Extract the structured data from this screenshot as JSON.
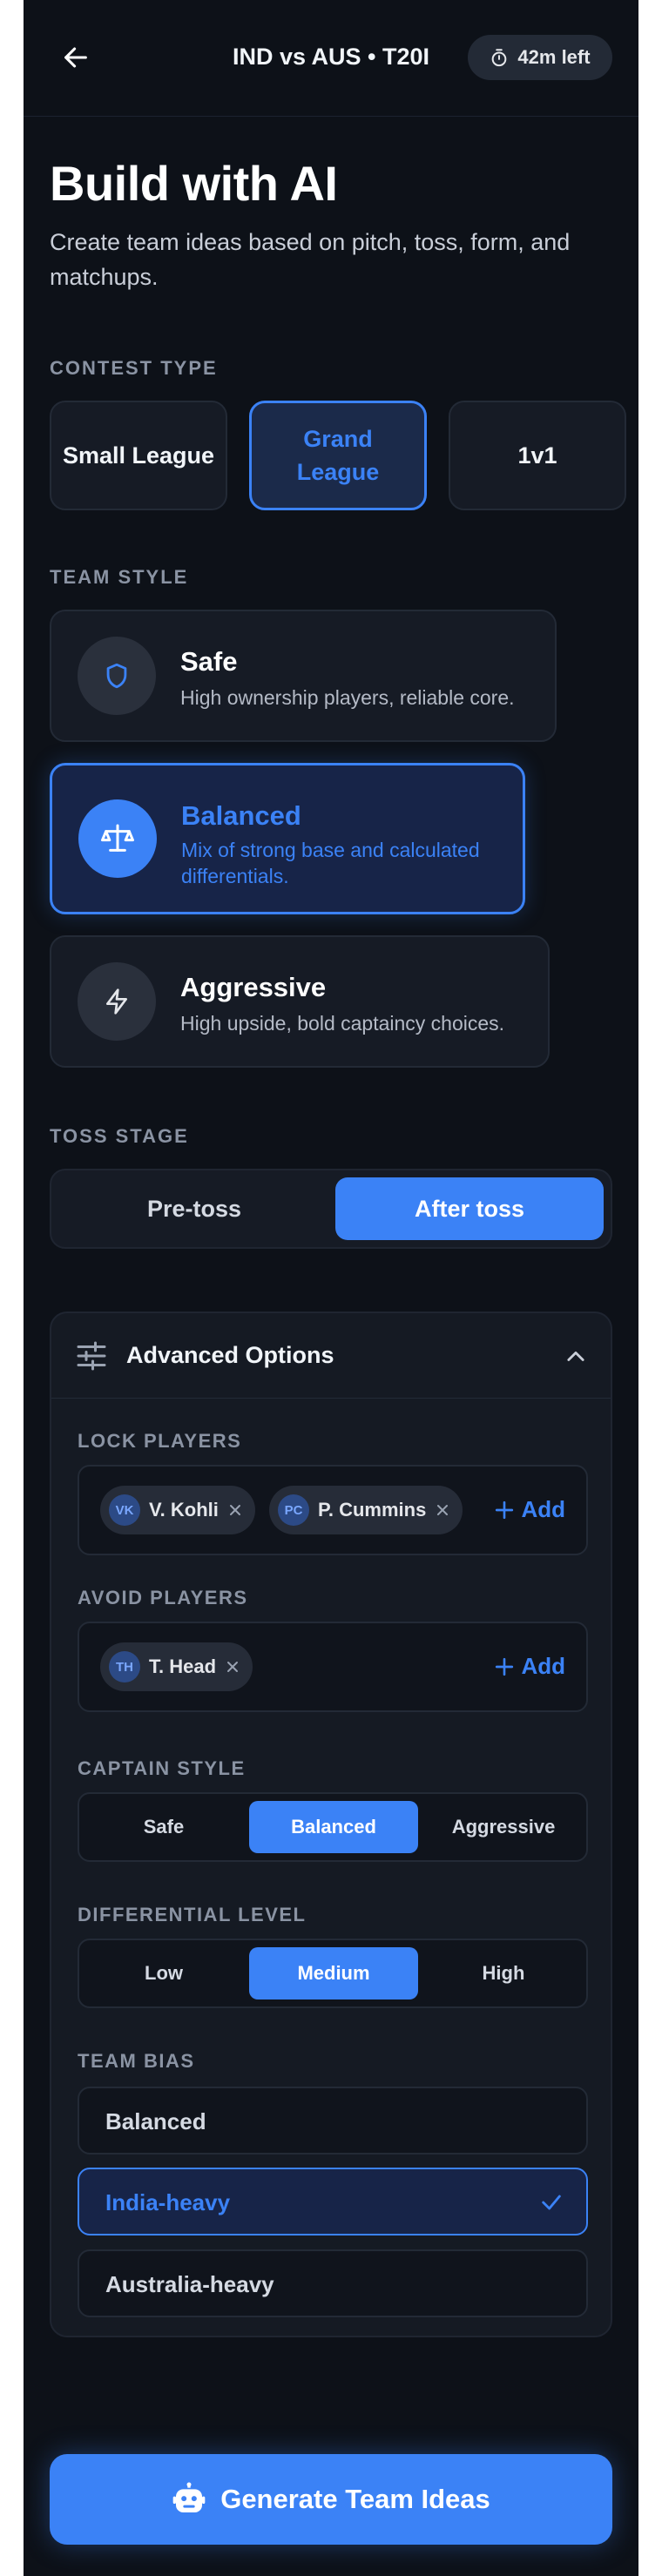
{
  "header": {
    "match_title": "IND vs AUS • T20I",
    "timer": "42m left",
    "back_icon": "arrow-left-icon",
    "timer_icon": "stopwatch-icon"
  },
  "hero": {
    "title": "Build with AI",
    "subtitle": "Create team ideas based on pitch, toss, form, and matchups."
  },
  "contest": {
    "label": "CONTEST TYPE",
    "options": [
      "Small League",
      "Grand League",
      "1v1"
    ],
    "selected": "Grand League"
  },
  "team_style": {
    "label": "TEAM STYLE",
    "options": [
      {
        "title": "Safe",
        "desc": "High ownership players, reliable core.",
        "icon": "shield-icon"
      },
      {
        "title": "Balanced",
        "desc": "Mix of strong base and calculated differentials.",
        "icon": "scale-icon"
      },
      {
        "title": "Aggressive",
        "desc": "High upside, bold captaincy choices.",
        "icon": "lightning-icon"
      }
    ],
    "selected": "Balanced"
  },
  "toss": {
    "label": "TOSS STAGE",
    "options": [
      "Pre-toss",
      "After toss"
    ],
    "selected": "After toss"
  },
  "advanced": {
    "title": "Advanced Options",
    "lock_label": "LOCK PLAYERS",
    "lock_players": [
      {
        "initials": "VK",
        "name": "V. Kohli"
      },
      {
        "initials": "PC",
        "name": "P. Cummins"
      }
    ],
    "avoid_label": "AVOID PLAYERS",
    "avoid_players": [
      {
        "initials": "TH",
        "name": "T. Head"
      }
    ],
    "add_label": "Add",
    "captain_label": "CAPTAIN STYLE",
    "captain_options": [
      "Safe",
      "Balanced",
      "Aggressive"
    ],
    "captain_selected": "Balanced",
    "diff_label": "DIFFERENTIAL LEVEL",
    "diff_options": [
      "Low",
      "Medium",
      "High"
    ],
    "diff_selected": "Medium",
    "bias_label": "TEAM BIAS",
    "bias_options": [
      "Balanced",
      "India-heavy",
      "Australia-heavy"
    ],
    "bias_selected": "India-heavy"
  },
  "cta": {
    "label": "Generate Team Ideas",
    "icon": "robot-icon"
  },
  "colors": {
    "accent": "#3b82f6",
    "background": "#0d1118",
    "card": "#161b25"
  }
}
